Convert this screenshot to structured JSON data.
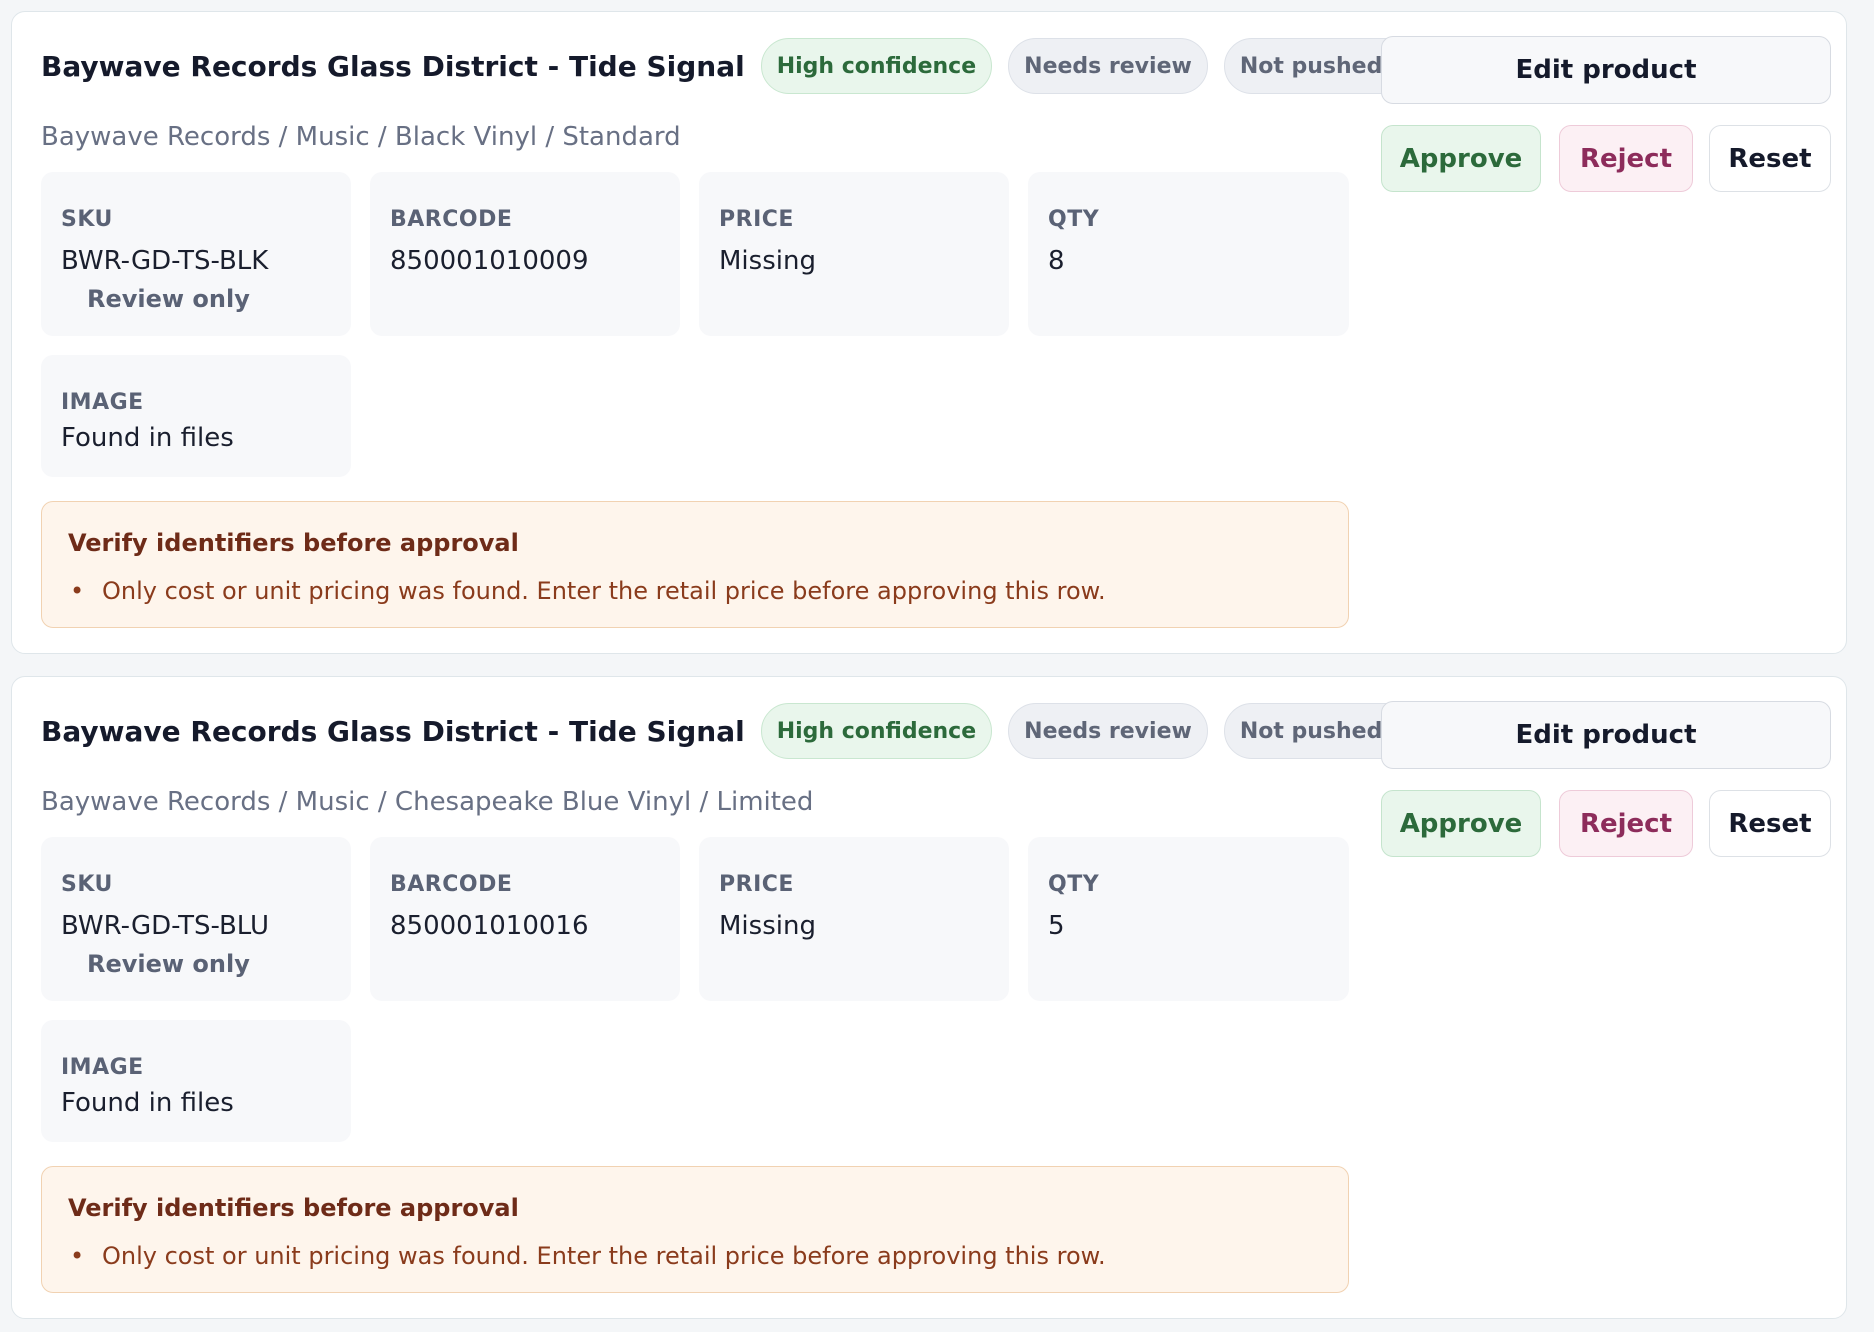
{
  "actions": {
    "edit_label": "Edit product",
    "approve_label": "Approve",
    "reject_label": "Reject",
    "reset_label": "Reset"
  },
  "products": [
    {
      "title": "Baywave Records Glass District - Tide Signal",
      "badges": {
        "confidence": "High confidence",
        "review": "Needs review",
        "push": "Not pushed yet"
      },
      "breadcrumb": "Baywave Records / Music / Black Vinyl / Standard",
      "sku": {
        "label": "SKU",
        "value": "BWR-GD-TS-BLK",
        "note": "Review only"
      },
      "barcode": {
        "label": "BARCODE",
        "value": "850001010009"
      },
      "price": {
        "label": "PRICE",
        "value": "Missing"
      },
      "qty": {
        "label": "QTY",
        "value": "8"
      },
      "image": {
        "label": "IMAGE",
        "value": "Found in files"
      },
      "warning": {
        "title": "Verify identifiers before approval",
        "items": [
          "Only cost or unit pricing was found. Enter the retail price before approving this row."
        ]
      }
    },
    {
      "title": "Baywave Records Glass District - Tide Signal",
      "badges": {
        "confidence": "High confidence",
        "review": "Needs review",
        "push": "Not pushed yet"
      },
      "breadcrumb": "Baywave Records / Music / Chesapeake Blue Vinyl / Limited",
      "sku": {
        "label": "SKU",
        "value": "BWR-GD-TS-BLU",
        "note": "Review only"
      },
      "barcode": {
        "label": "BARCODE",
        "value": "850001010016"
      },
      "price": {
        "label": "PRICE",
        "value": "Missing"
      },
      "qty": {
        "label": "QTY",
        "value": "5"
      },
      "image": {
        "label": "IMAGE",
        "value": "Found in files"
      },
      "warning": {
        "title": "Verify identifiers before approval",
        "items": [
          "Only cost or unit pricing was found. Enter the retail price before approving this row."
        ]
      }
    }
  ]
}
